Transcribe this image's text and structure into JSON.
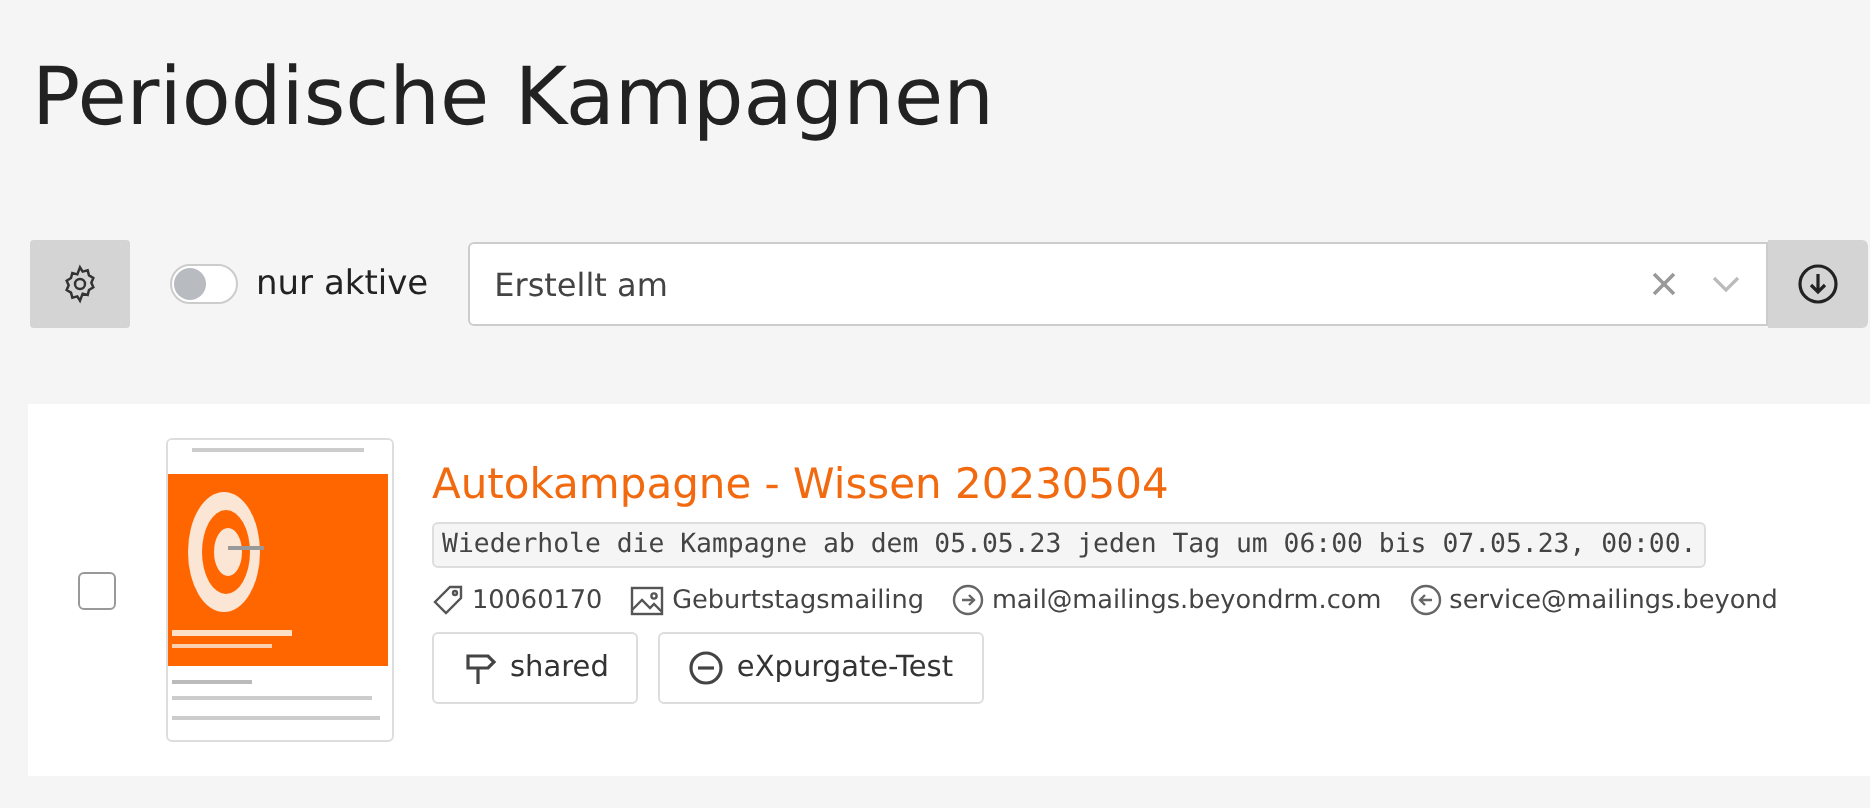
{
  "title": "Periodische Kampagnen",
  "toolbar": {
    "active_only": {
      "label": "nur aktive",
      "on": false
    },
    "sort": {
      "placeholder": "Erstellt am"
    }
  },
  "campaigns": [
    {
      "selected": false,
      "name": "Autokampagne - Wissen 20230504",
      "schedule": "Wiederhole die Kampagne ab dem 05.05.23 jeden Tag um 06:00 bis 07.05.23, 00:00.",
      "id": "10060170",
      "mailing": "Geburtstagsmailing",
      "sender": "mail@mailings.beyondrm.com",
      "reply_to": "service@mailings.beyond",
      "tags": [
        {
          "kind": "signpost",
          "label": "shared"
        },
        {
          "kind": "minus",
          "label": "eXpurgate-Test"
        }
      ]
    }
  ]
}
